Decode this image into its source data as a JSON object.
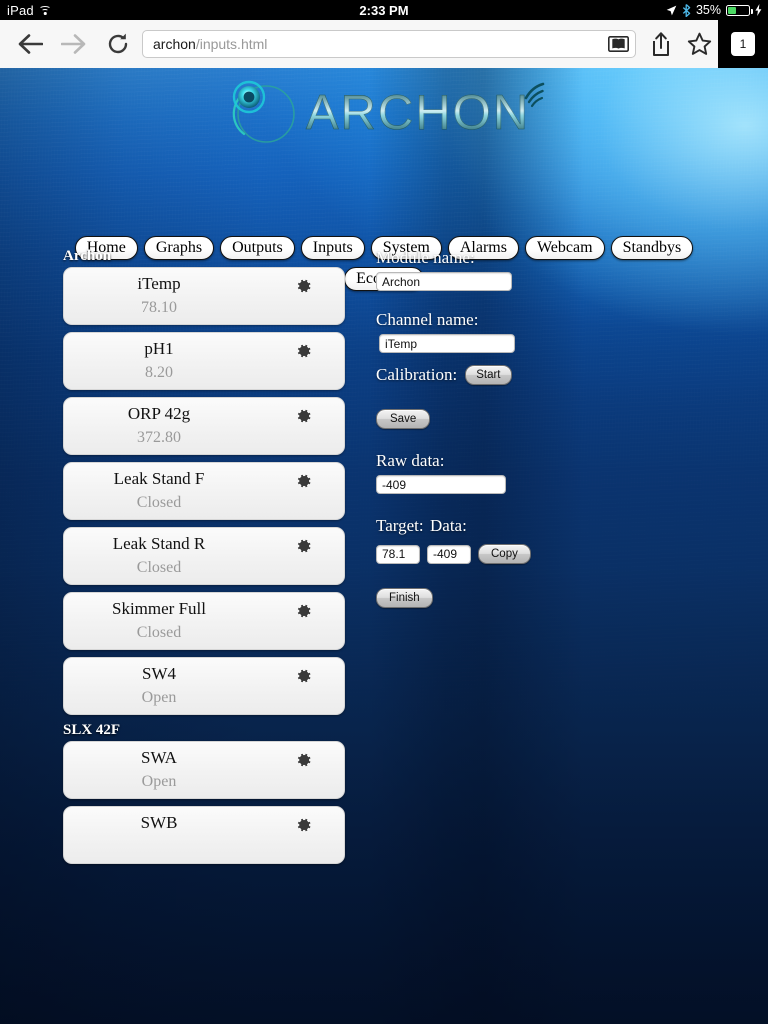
{
  "statusbar": {
    "carrier": "iPad",
    "wifi_icon": "wifi-icon",
    "time": "2:33 PM",
    "location_icon": "location-arrow-icon",
    "bluetooth_icon": "bluetooth-icon",
    "battery_pct": "35%",
    "charging_icon": "lightning-bolt-icon"
  },
  "browser": {
    "back_icon": "back-arrow-icon",
    "forward_icon": "forward-arrow-icon",
    "reload_icon": "reload-icon",
    "url_host": "archon",
    "url_path": "/inputs.html",
    "reader_icon": "reader-view-icon",
    "share_icon": "share-icon",
    "bookmark_icon": "bookmark-star-icon",
    "tab_count": "1"
  },
  "logo": {
    "text": "ARCHON",
    "mark_icon": "archon-swirl-icon",
    "signal_icon": "signal-arc-icon"
  },
  "nav": {
    "row1": [
      "Home",
      "Graphs",
      "Outputs",
      "Inputs",
      "System",
      "Alarms",
      "Webcam",
      "Standbys"
    ],
    "row2": [
      "EcoTech"
    ]
  },
  "channel_list": [
    {
      "group": "Archon",
      "items": [
        {
          "name": "iTemp",
          "value": "78.10",
          "gear_icon": "gear-icon"
        },
        {
          "name": "pH1",
          "value": "8.20",
          "gear_icon": "gear-icon"
        },
        {
          "name": "ORP 42g",
          "value": "372.80",
          "gear_icon": "gear-icon"
        },
        {
          "name": "Leak Stand F",
          "value": "Closed",
          "gear_icon": "gear-icon"
        },
        {
          "name": "Leak Stand R",
          "value": "Closed",
          "gear_icon": "gear-icon"
        },
        {
          "name": "Skimmer Full",
          "value": "Closed",
          "gear_icon": "gear-icon"
        },
        {
          "name": "SW4",
          "value": "Open",
          "gear_icon": "gear-icon"
        }
      ]
    },
    {
      "group": "SLX 42F",
      "items": [
        {
          "name": "SWA",
          "value": "Open",
          "gear_icon": "gear-icon"
        },
        {
          "name": "SWB",
          "value": "",
          "gear_icon": "gear-icon"
        }
      ]
    }
  ],
  "form": {
    "module_label": "Module name:",
    "module_value": "Archon",
    "channel_label": "Channel name:",
    "channel_value": "iTemp",
    "calibration_label": "Calibration:",
    "start_button": "Start",
    "save_button": "Save",
    "raw_label": "Raw data:",
    "raw_value": "-409",
    "target_label": "Target:",
    "data_label": "Data:",
    "target_value": "78.1",
    "data_value": "-409",
    "copy_button": "Copy",
    "finish_button": "Finish"
  },
  "colors": {
    "ocean_light": "#2f86d6",
    "ocean_dark": "#061a3a",
    "card_bg": "#f2f2f2",
    "value_text": "#9a9a9a",
    "logo_teal": "#0a5560",
    "battery_green": "#4cd964"
  }
}
